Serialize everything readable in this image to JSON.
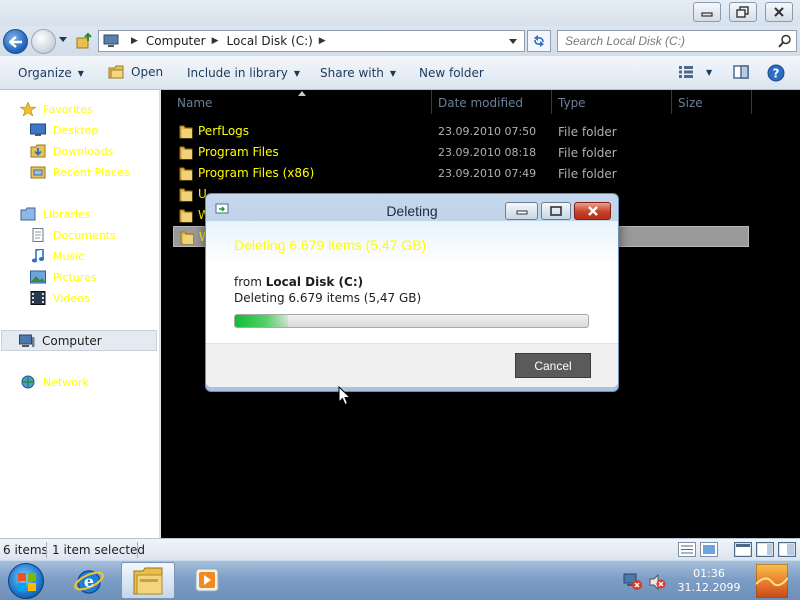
{
  "window": {
    "buttons": [
      "minimize",
      "restore",
      "close"
    ]
  },
  "address": {
    "crumbs": [
      "Computer",
      "Local Disk (C:)"
    ],
    "search_placeholder": "Search Local Disk (C:)"
  },
  "toolbar": {
    "organize": "Organize",
    "open": "Open",
    "include_in_library": "Include in library",
    "share_with": "Share with",
    "new_folder": "New folder"
  },
  "sidebar": {
    "favorites": "Favorites",
    "desktop": "Desktop",
    "downloads": "Downloads",
    "recent_places": "Recent Places",
    "libraries": "Libraries",
    "documents": "Documents",
    "music": "Music",
    "pictures": "Pictures",
    "videos": "Videos",
    "computer": "Computer",
    "network": "Network"
  },
  "columns": {
    "name": "Name",
    "date_modified": "Date modified",
    "type": "Type",
    "size": "Size"
  },
  "files": [
    {
      "name": "PerfLogs",
      "date": "23.09.2010 07:50",
      "type": "File folder"
    },
    {
      "name": "Program Files",
      "date": "23.09.2010 08:18",
      "type": "File folder"
    },
    {
      "name": "Program Files (x86)",
      "date": "23.09.2010 07:49",
      "type": "File folder"
    },
    {
      "name": "U",
      "date": "",
      "type": ""
    },
    {
      "name": "W",
      "date": "",
      "type": ""
    },
    {
      "name": "W",
      "date": "",
      "type": ""
    }
  ],
  "dialog": {
    "title": "Deleting",
    "header": "Deleting 6.679 items (5,47 GB)",
    "from_prefix": "from",
    "from_location": "Local Disk (C:)",
    "items_text": "Deleting 6.679 items (5,47 GB)",
    "progress_percent": 15,
    "cancel_label": "Cancel"
  },
  "status": {
    "item_count": "6 items",
    "selection": "1 item selected"
  },
  "taskbar": {
    "time": "01:36",
    "date": "31.12.2099"
  },
  "colors": {
    "highlight_text": "#ffff00",
    "list_background": "#000000",
    "progress_green": "#0fbd34"
  }
}
